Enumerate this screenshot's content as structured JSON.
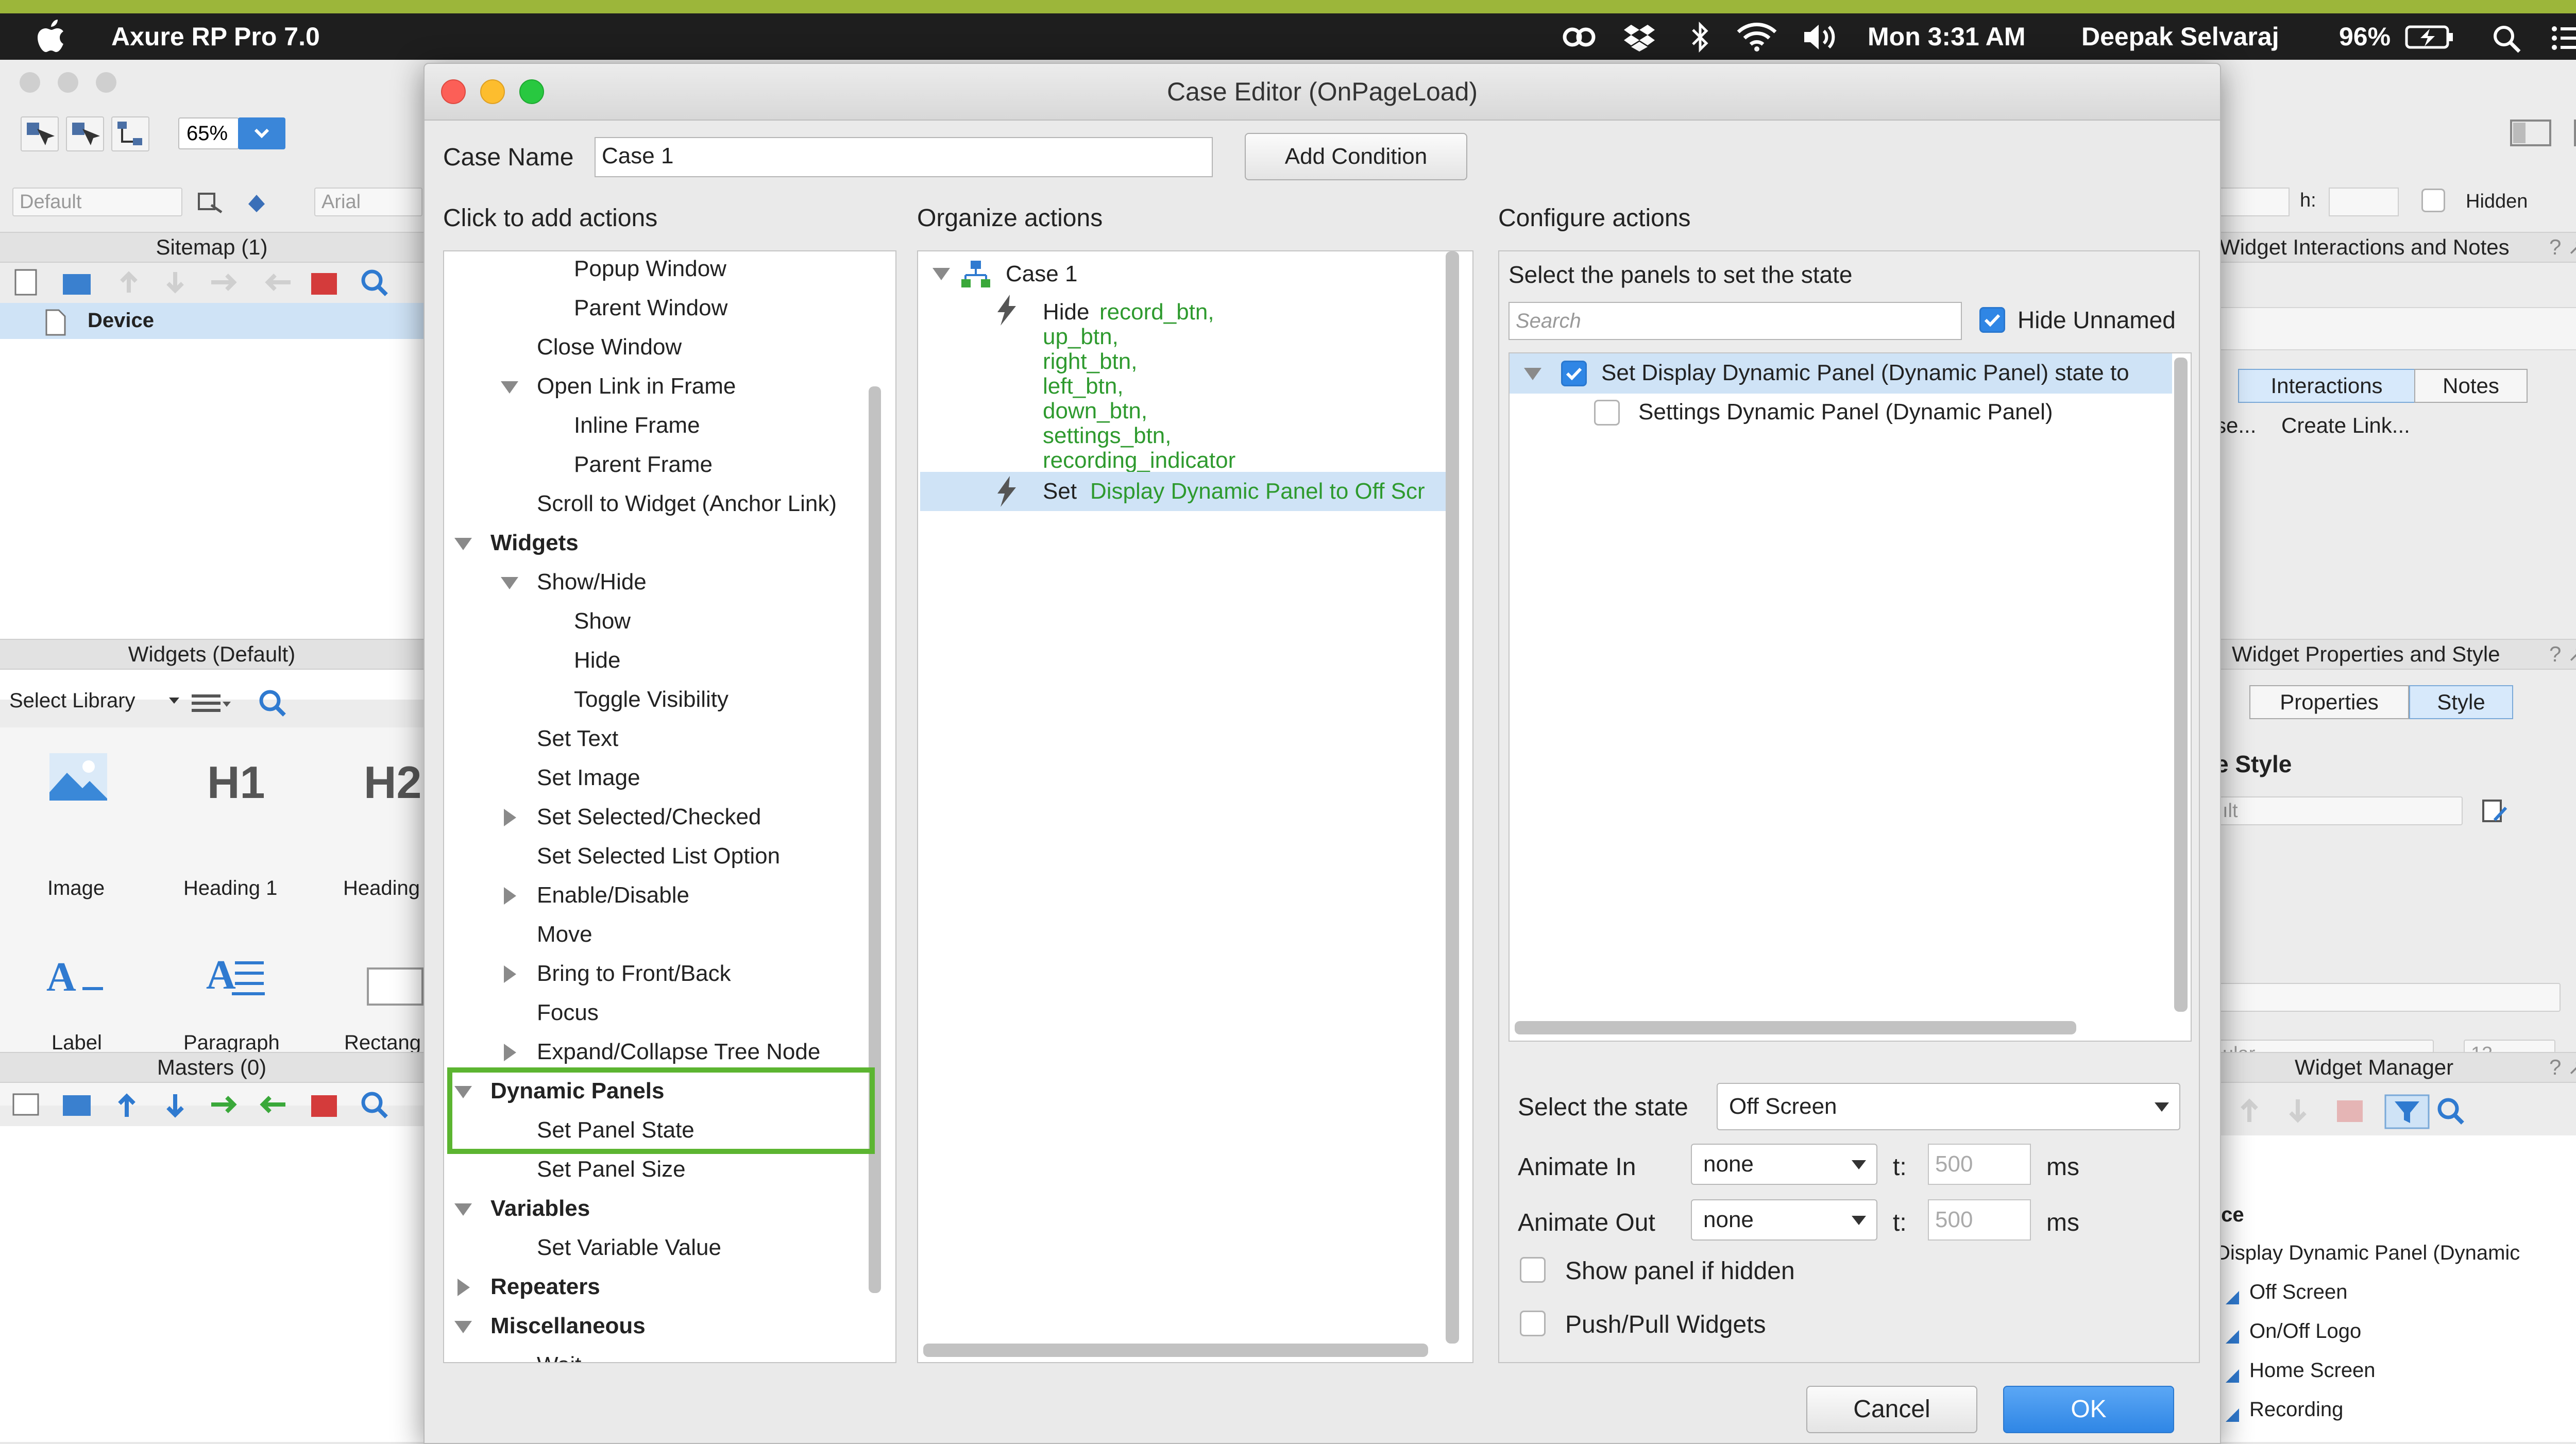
{
  "menubar": {
    "app_name": "Axure RP Pro 7.0",
    "clock": "Mon 3:31 AM",
    "user": "Deepak Selvaraj",
    "battery": "96%",
    "icons": [
      "apple-icon",
      "creative-cloud-icon",
      "dropbox-icon",
      "bluetooth-icon",
      "wifi-icon",
      "volume-icon",
      "battery-charging-icon",
      "spotlight-search-icon",
      "notification-list-icon"
    ]
  },
  "background": {
    "zoom": "65%",
    "style_select": "Default",
    "font_select": "Arial",
    "sitemap": {
      "title": "Sitemap (1)",
      "page": "Device"
    },
    "widgets": {
      "title": "Widgets (Default)",
      "library_label": "Select Library",
      "items": [
        {
          "label": "Image",
          "glyph": ""
        },
        {
          "label": "Heading 1",
          "glyph": "H1"
        },
        {
          "label": "Heading",
          "glyph": "H2"
        },
        {
          "label": "Label",
          "glyph": "A"
        },
        {
          "label": "Paragraph",
          "glyph": "A"
        },
        {
          "label": "Rectang",
          "glyph": ""
        }
      ]
    },
    "masters": {
      "title": "Masters (0)"
    },
    "right": {
      "h_label": "h:",
      "hidden_label": "Hidden",
      "interactions_panel": {
        "title": "Widget Interactions and Notes",
        "tabs": [
          "Interactions",
          "Notes"
        ],
        "link_text": "se...",
        "create_link": "Create Link..."
      },
      "properties_panel": {
        "title": "Widget Properties and Style",
        "tabs": [
          "Properties",
          "Style"
        ],
        "heading": "e Style",
        "style_value": "ılt",
        "font_weight": "ular",
        "font_size": "13"
      },
      "manager_panel": {
        "title": "Widget Manager",
        "root": "ice",
        "panel": "Display Dynamic Panel (Dynamic",
        "states": [
          "Off Screen",
          "On/Off Logo",
          "Home Screen",
          "Recording"
        ]
      },
      "panel_controls": "? ↗ ✕"
    }
  },
  "dialog": {
    "title": "Case Editor (OnPageLoad)",
    "case_name_label": "Case Name",
    "case_name_value": "Case 1",
    "add_condition": "Add Condition",
    "click_to_add_heading": "Click to add actions",
    "organize_heading": "Organize actions",
    "configure_heading": "Configure actions",
    "actions_tree": [
      {
        "label": "Popup Window",
        "level": 2,
        "bold": false,
        "arrow": ""
      },
      {
        "label": "Parent Window",
        "level": 2,
        "bold": false,
        "arrow": ""
      },
      {
        "label": "Close Window",
        "level": 1,
        "bold": false,
        "arrow": ""
      },
      {
        "label": "Open Link in Frame",
        "level": 1,
        "bold": false,
        "arrow": "down"
      },
      {
        "label": "Inline Frame",
        "level": 2,
        "bold": false,
        "arrow": ""
      },
      {
        "label": "Parent Frame",
        "level": 2,
        "bold": false,
        "arrow": ""
      },
      {
        "label": "Scroll to Widget (Anchor Link)",
        "level": 1,
        "bold": false,
        "arrow": ""
      },
      {
        "label": "Widgets",
        "level": 0,
        "bold": true,
        "arrow": "down"
      },
      {
        "label": "Show/Hide",
        "level": 1,
        "bold": false,
        "arrow": "down"
      },
      {
        "label": "Show",
        "level": 2,
        "bold": false,
        "arrow": ""
      },
      {
        "label": "Hide",
        "level": 2,
        "bold": false,
        "arrow": ""
      },
      {
        "label": "Toggle Visibility",
        "level": 2,
        "bold": false,
        "arrow": ""
      },
      {
        "label": "Set Text",
        "level": 1,
        "bold": false,
        "arrow": ""
      },
      {
        "label": "Set Image",
        "level": 1,
        "bold": false,
        "arrow": ""
      },
      {
        "label": "Set Selected/Checked",
        "level": 1,
        "bold": false,
        "arrow": "right"
      },
      {
        "label": "Set Selected List Option",
        "level": 1,
        "bold": false,
        "arrow": ""
      },
      {
        "label": "Enable/Disable",
        "level": 1,
        "bold": false,
        "arrow": "right"
      },
      {
        "label": "Move",
        "level": 1,
        "bold": false,
        "arrow": ""
      },
      {
        "label": "Bring to Front/Back",
        "level": 1,
        "bold": false,
        "arrow": "right"
      },
      {
        "label": "Focus",
        "level": 1,
        "bold": false,
        "arrow": ""
      },
      {
        "label": "Expand/Collapse Tree Node",
        "level": 1,
        "bold": false,
        "arrow": "right"
      },
      {
        "label": "Dynamic Panels",
        "level": 0,
        "bold": true,
        "arrow": "down"
      },
      {
        "label": "Set Panel State",
        "level": 1,
        "bold": false,
        "arrow": ""
      },
      {
        "label": "Set Panel Size",
        "level": 1,
        "bold": false,
        "arrow": ""
      },
      {
        "label": "Variables",
        "level": 0,
        "bold": true,
        "arrow": "down"
      },
      {
        "label": "Set Variable Value",
        "level": 1,
        "bold": false,
        "arrow": ""
      },
      {
        "label": "Repeaters",
        "level": 0,
        "bold": true,
        "arrow": "right"
      },
      {
        "label": "Miscellaneous",
        "level": 0,
        "bold": true,
        "arrow": "down"
      },
      {
        "label": "Wait",
        "level": 1,
        "bold": false,
        "arrow": ""
      }
    ],
    "highlight_color": "#5cb531",
    "organize": {
      "case_label": "Case 1",
      "hide_action": {
        "verb": "Hide",
        "targets": [
          "record_btn,",
          "up_btn,",
          "right_btn,",
          "left_btn,",
          "down_btn,",
          "settings_btn,",
          "recording_indicator"
        ]
      },
      "set_action": {
        "verb": "Set",
        "target": "Display Dynamic Panel to Off Scr"
      }
    },
    "configure": {
      "panels_heading": "Select the panels to set the state",
      "search_placeholder": "Search",
      "hide_unnamed": "Hide Unnamed",
      "panels": [
        {
          "label": "Set Display Dynamic Panel (Dynamic Panel) state to",
          "checked": true
        },
        {
          "label": "Settings Dynamic Panel (Dynamic Panel)",
          "checked": false
        }
      ],
      "state_label": "Select the state",
      "state_value": "Off Screen",
      "animate_in_label": "Animate In",
      "animate_in_value": "none",
      "animate_out_label": "Animate Out",
      "animate_out_value": "none",
      "t_label": "t:",
      "t_in": "500",
      "t_out": "500",
      "ms": "ms",
      "show_if_hidden": "Show panel if hidden",
      "push_pull": "Push/Pull Widgets"
    },
    "cancel": "Cancel",
    "ok": "OK",
    "accent": "#2f86e5"
  }
}
